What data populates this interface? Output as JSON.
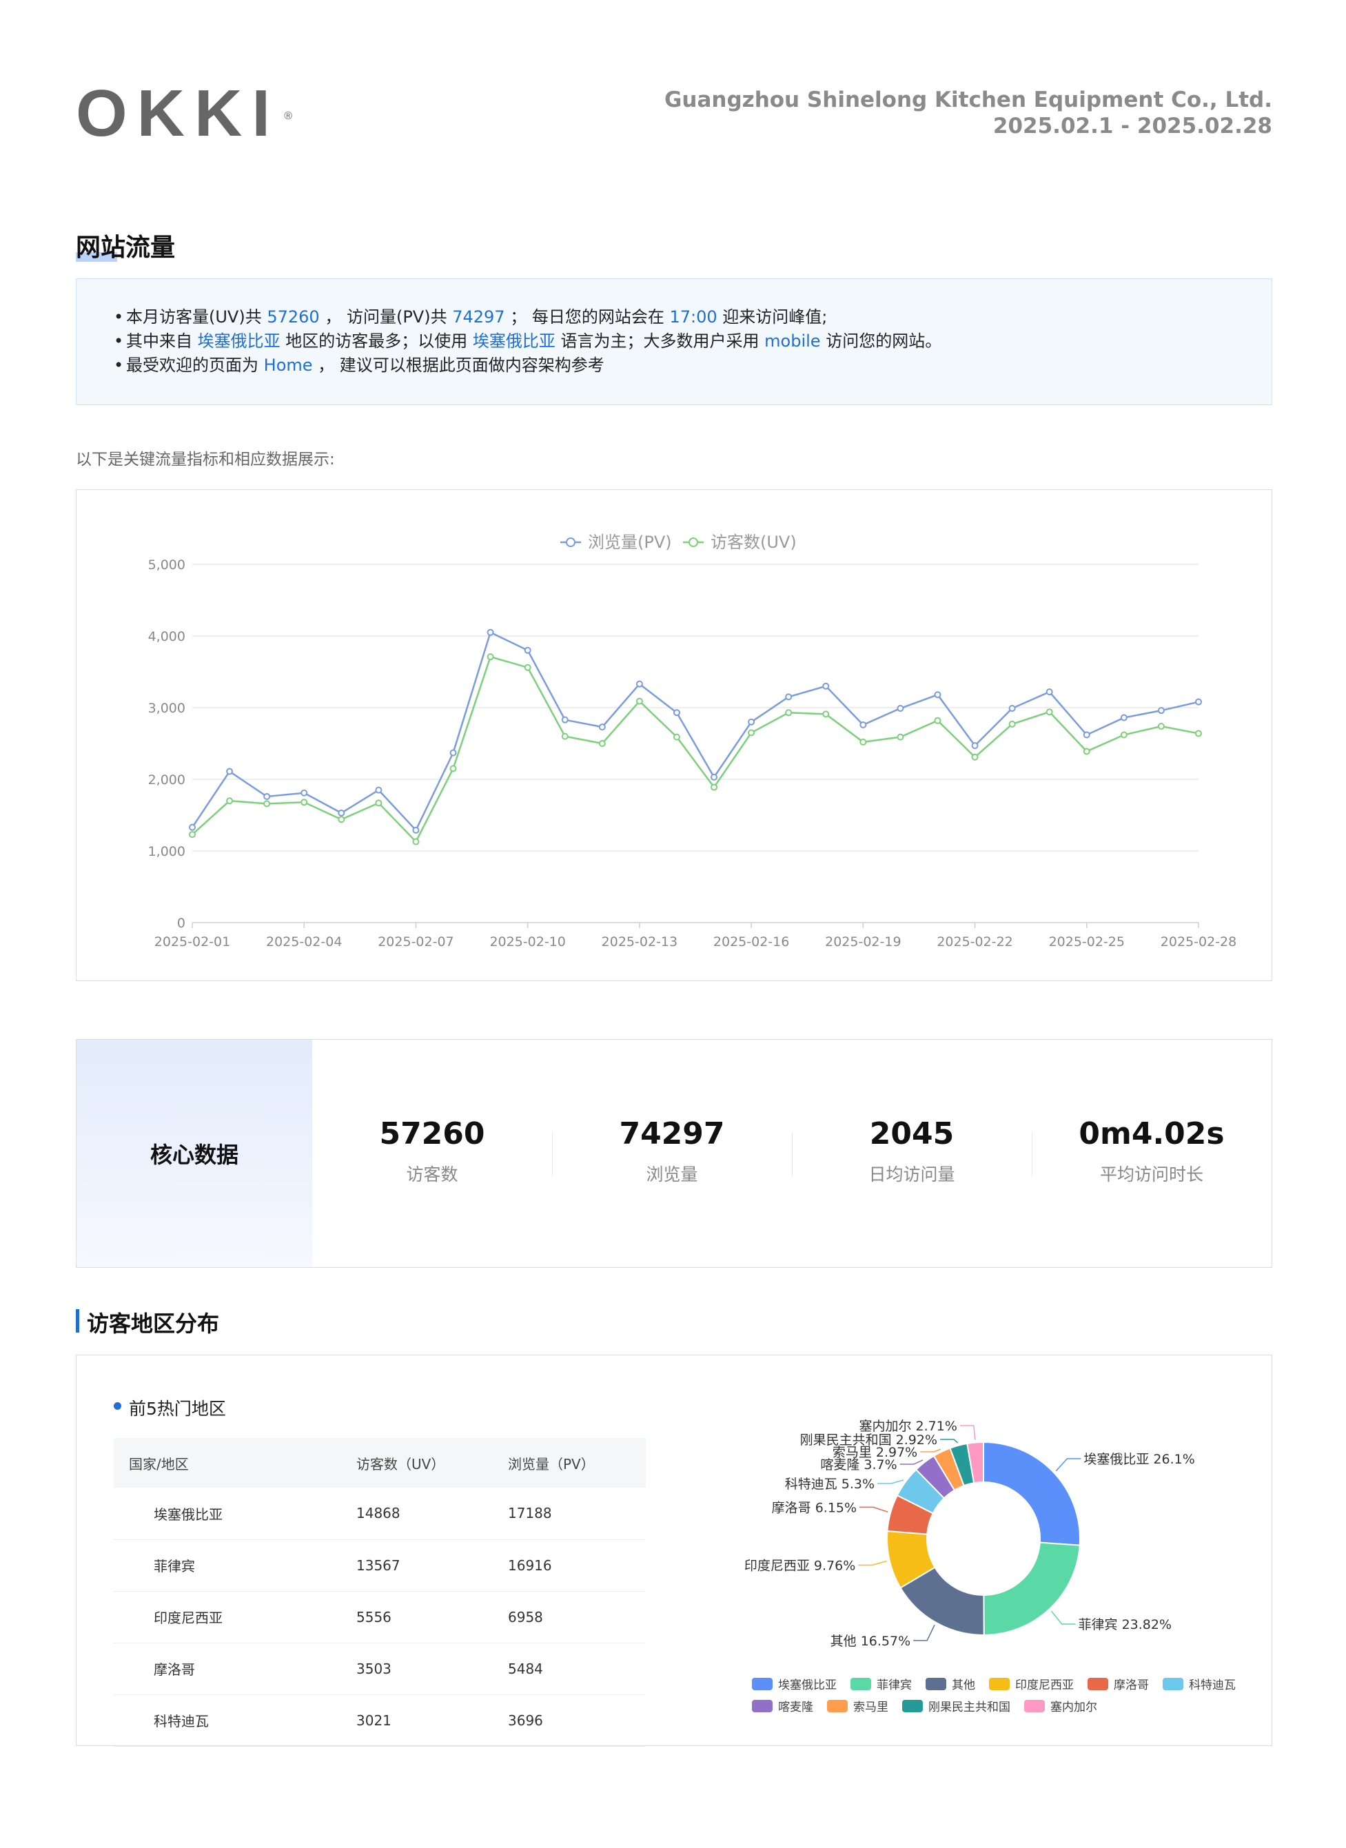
{
  "header": {
    "logo_text": "OKKI",
    "logo_mark": "®",
    "company": "Guangzhou Shinelong Kitchen Equipment Co., Ltd.",
    "date_range": "2025.02.1 - 2025.02.28"
  },
  "traffic": {
    "title": "网站流量",
    "summary": {
      "l1_a": "本月访客量(UV)共 ",
      "uv": "57260",
      "l1_b": " ， 访问量(PV)共 ",
      "pv": "74297",
      "l1_c": " ； 每日您的网站会在 ",
      "peak": "17:00",
      "l1_d": " 迎来访问峰值;",
      "l2_a": "其中来自 ",
      "region": "埃塞俄比亚",
      "l2_b": " 地区的访客最多；以使用 ",
      "language": "埃塞俄比亚",
      "l2_c": " 语言为主；大多数用户采用 ",
      "device": "mobile",
      "l2_d": " 访问您的网站。",
      "l3_a": "最受欢迎的页面为 ",
      "page": "Home",
      "l3_b": " ， 建议可以根据此页面做内容架构参考"
    },
    "intro": "以下是关键流量指标和相应数据展示:"
  },
  "chart_data": {
    "type": "line",
    "x": [
      "2025-02-01",
      "2025-02-02",
      "2025-02-03",
      "2025-02-04",
      "2025-02-05",
      "2025-02-06",
      "2025-02-07",
      "2025-02-08",
      "2025-02-09",
      "2025-02-10",
      "2025-02-11",
      "2025-02-12",
      "2025-02-13",
      "2025-02-14",
      "2025-02-15",
      "2025-02-16",
      "2025-02-17",
      "2025-02-18",
      "2025-02-19",
      "2025-02-20",
      "2025-02-21",
      "2025-02-22",
      "2025-02-23",
      "2025-02-24",
      "2025-02-25",
      "2025-02-26",
      "2025-02-27",
      "2025-02-28"
    ],
    "x_tick_labels": [
      "2025-02-01",
      "2025-02-04",
      "2025-02-07",
      "2025-02-10",
      "2025-02-13",
      "2025-02-16",
      "2025-02-19",
      "2025-02-22",
      "2025-02-25",
      "2025-02-28"
    ],
    "series": [
      {
        "name": "浏览量(PV)",
        "color": "#7b9be0",
        "values": [
          1330,
          2110,
          1760,
          1810,
          1530,
          1850,
          1290,
          2370,
          4050,
          3800,
          2830,
          2730,
          3330,
          2930,
          2030,
          2800,
          3150,
          3300,
          2760,
          2990,
          3180,
          2470,
          2990,
          3220,
          2620,
          2860,
          2960,
          3080
        ]
      },
      {
        "name": "访客数(UV)",
        "color": "#7dd07b",
        "values": [
          1230,
          1700,
          1660,
          1680,
          1440,
          1670,
          1130,
          2150,
          3710,
          3560,
          2600,
          2500,
          3090,
          2590,
          1890,
          2650,
          2930,
          2910,
          2520,
          2590,
          2820,
          2310,
          2770,
          2940,
          2390,
          2620,
          2740,
          2640
        ]
      }
    ],
    "y_ticks": [
      "0",
      "1,000",
      "2,000",
      "3,000",
      "4,000",
      "5,000"
    ],
    "ylim": [
      0,
      5000
    ],
    "grid": true,
    "legend_position": "top-center"
  },
  "core": {
    "label": "核心数据",
    "kpis": [
      {
        "value": "57260",
        "label": "访客数"
      },
      {
        "value": "74297",
        "label": "浏览量"
      },
      {
        "value": "2045",
        "label": "日均访问量"
      },
      {
        "value": "0m4.02s",
        "label": "平均访问时长"
      }
    ]
  },
  "region": {
    "title": "访客地区分布",
    "top5_label": "前5热门地区",
    "table": {
      "headers": [
        "国家/地区",
        "访客数（UV）",
        "浏览量（PV）"
      ],
      "rows": [
        [
          "埃塞俄比亚",
          "14868",
          "17188"
        ],
        [
          "菲律宾",
          "13567",
          "16916"
        ],
        [
          "印度尼西亚",
          "5556",
          "6958"
        ],
        [
          "摩洛哥",
          "3503",
          "5484"
        ],
        [
          "科特迪瓦",
          "3021",
          "3696"
        ]
      ]
    },
    "pie": {
      "type": "pie",
      "slices": [
        {
          "name": "埃塞俄比亚",
          "label": "埃塞俄比亚 26.1%",
          "value": 26.1,
          "color": "#5b8ff9"
        },
        {
          "name": "菲律宾",
          "label": "菲律宾 23.82%",
          "value": 23.82,
          "color": "#5ad8a6"
        },
        {
          "name": "其他",
          "label": "其他 16.57%",
          "value": 16.57,
          "color": "#5d7092"
        },
        {
          "name": "印度尼西亚",
          "label": "印度尼西亚 9.76%",
          "value": 9.76,
          "color": "#f6bd16"
        },
        {
          "name": "摩洛哥",
          "label": "摩洛哥 6.15%",
          "value": 6.15,
          "color": "#e8684a"
        },
        {
          "name": "科特迪瓦",
          "label": "科特迪瓦 5.3%",
          "value": 5.3,
          "color": "#6dc8ec"
        },
        {
          "name": "喀麦隆",
          "label": "喀麦隆 3.7%",
          "value": 3.7,
          "color": "#9270ca"
        },
        {
          "name": "索马里",
          "label": "索马里 2.97%",
          "value": 2.97,
          "color": "#ff9d4d"
        },
        {
          "name": "刚果民主共和国",
          "label": "刚果民主共和国 2.92%",
          "value": 2.92,
          "color": "#269a99"
        },
        {
          "name": "塞内加尔",
          "label": "塞内加尔 2.71%",
          "value": 2.71,
          "color": "#ff99c3"
        }
      ]
    }
  }
}
